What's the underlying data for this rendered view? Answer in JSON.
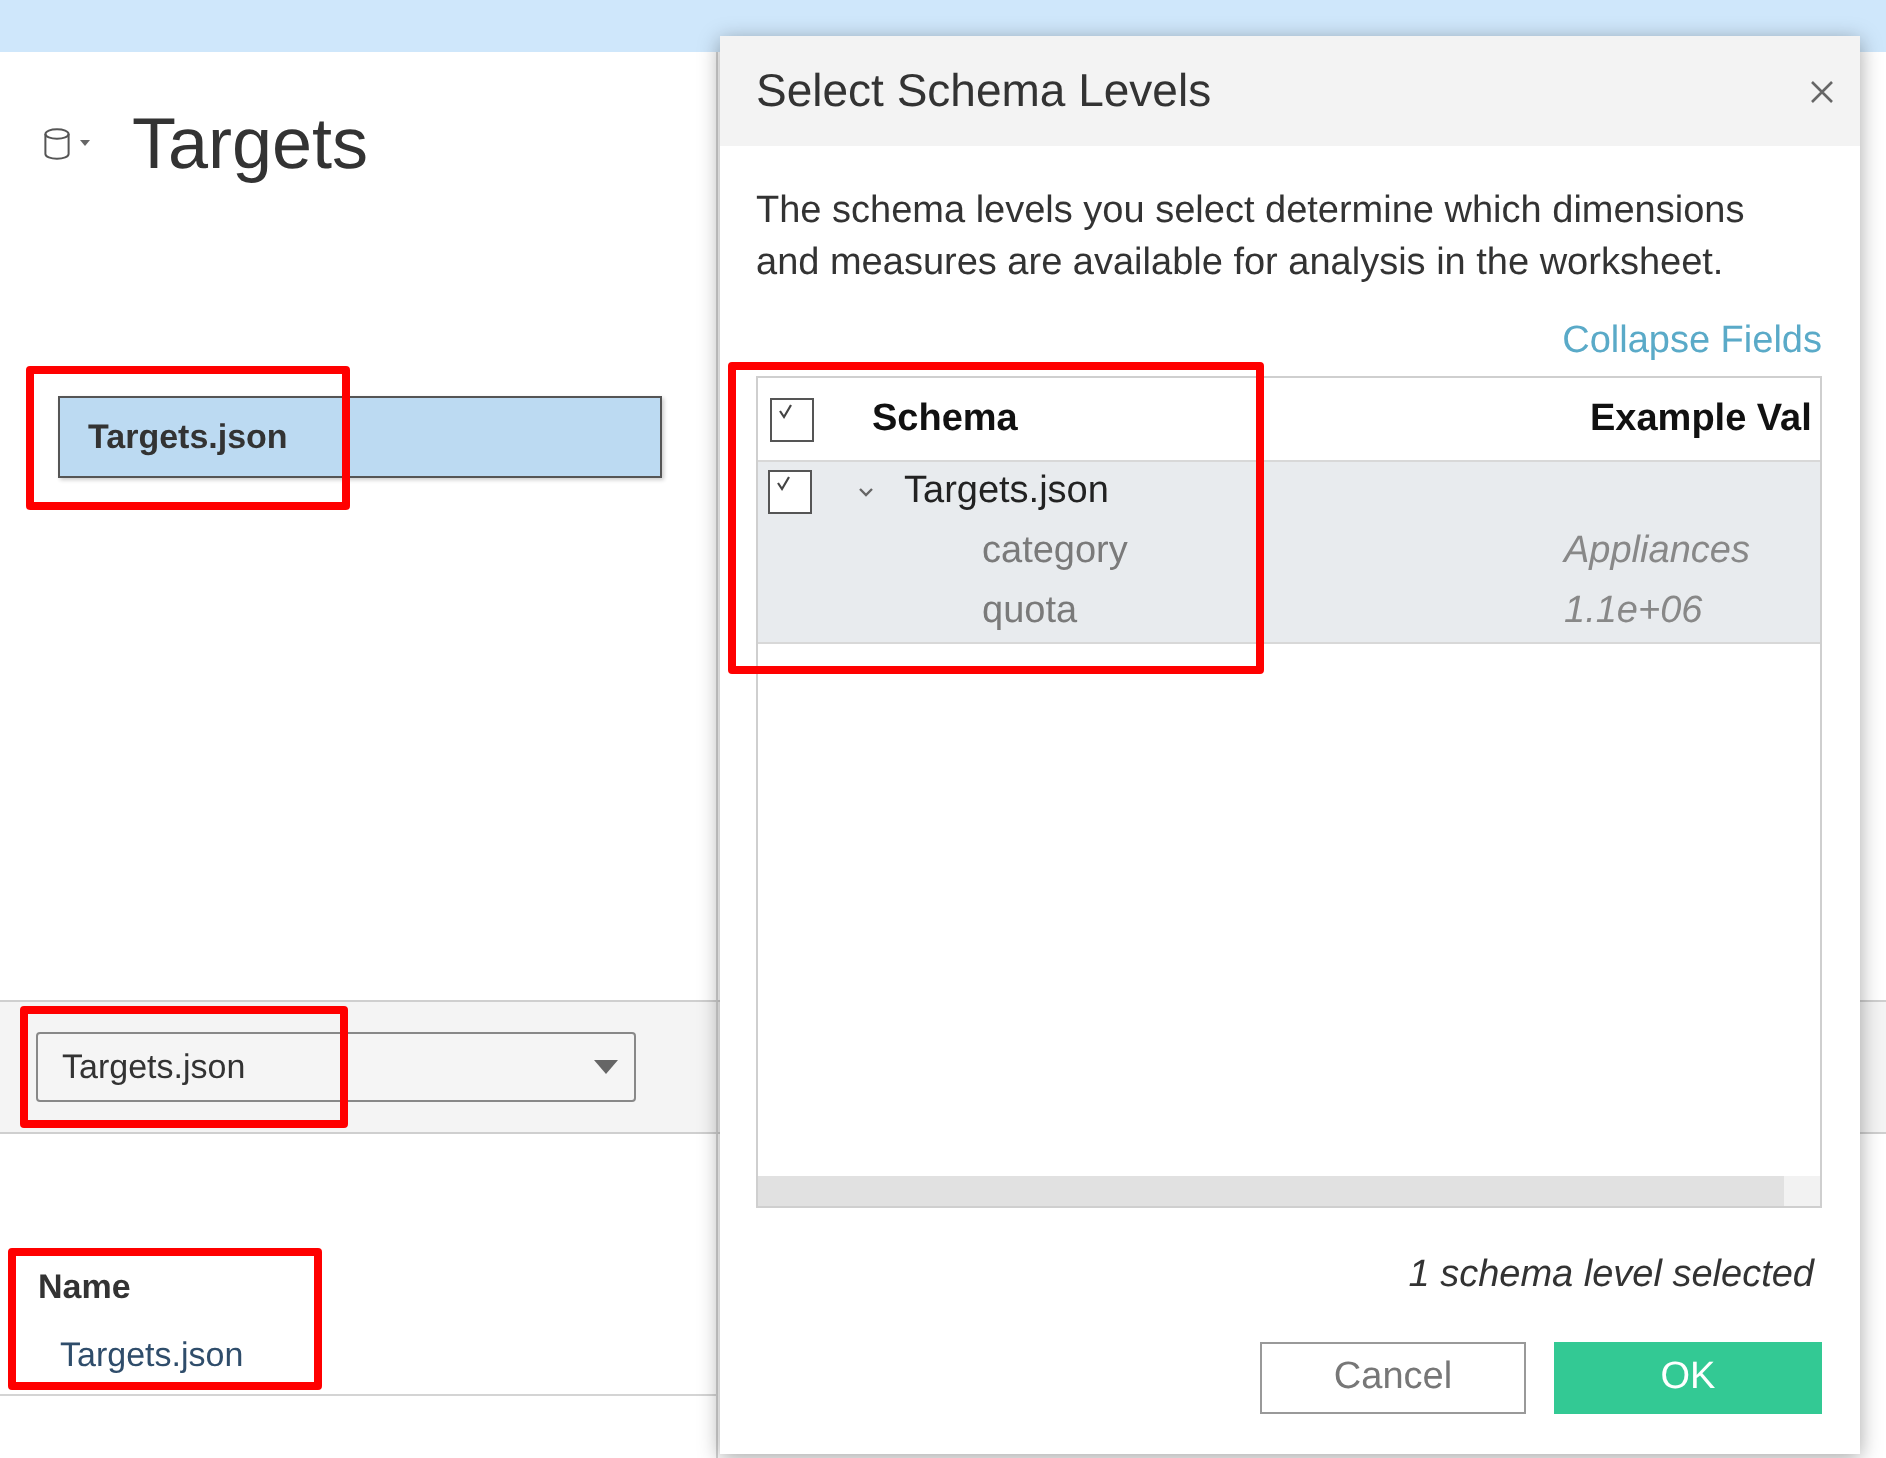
{
  "data_source": {
    "title": "Targets"
  },
  "connection": {
    "name": "Targets.json",
    "selected": true,
    "highlighted": true
  },
  "table_picker": {
    "value": "Targets.json",
    "highlighted": true
  },
  "name_list": {
    "heading": "Name",
    "items": [
      "Targets.json"
    ],
    "highlighted": true
  },
  "dialog": {
    "title": "Select Schema Levels",
    "description": "The schema levels you select determine which dimensions and measures are available for analysis in the worksheet.",
    "collapse_link": "Collapse Fields",
    "schema_table": {
      "all_checked": true,
      "columns": [
        "Schema",
        "Example Val"
      ],
      "rows": [
        {
          "name": "Targets.json",
          "checked": true,
          "expanded": true,
          "children": [
            {
              "name": "category",
              "example": "Appliances"
            },
            {
              "name": "quota",
              "example": "1.1e+06"
            }
          ]
        }
      ],
      "highlighted": true
    },
    "status": "1 schema level selected",
    "buttons": [
      {
        "label": "Cancel",
        "kind": "secondary"
      },
      {
        "label": "OK",
        "kind": "primary"
      }
    ]
  }
}
